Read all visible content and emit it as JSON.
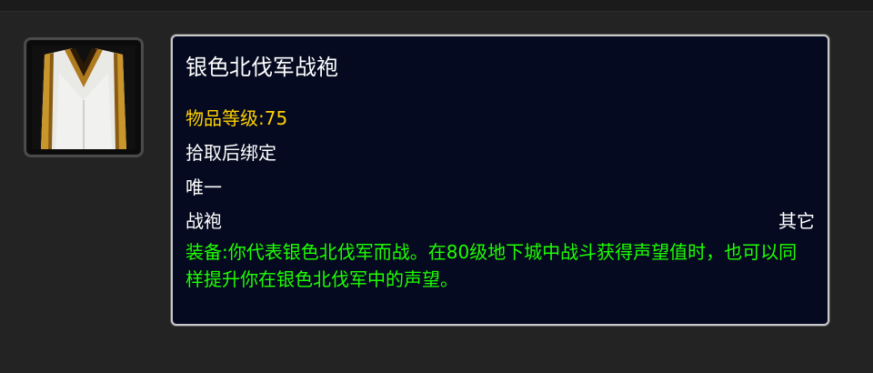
{
  "item": {
    "name": "银色北伐军战袍",
    "item_level": "物品等级:75",
    "bind": "拾取后绑定",
    "unique": "唯一",
    "slot": "战袍",
    "type": "其它",
    "effect": "装备:你代表银色北伐军而战。在80级地下城中战斗获得声望值时，也可以同样提升你在银色北伐军中的声望。"
  },
  "colors": {
    "name": "#ffffff",
    "item_level": "#ffd100",
    "effect": "#1eff00",
    "tooltip_bg": "#050a20"
  },
  "icon": "white-gold-tabard-icon"
}
